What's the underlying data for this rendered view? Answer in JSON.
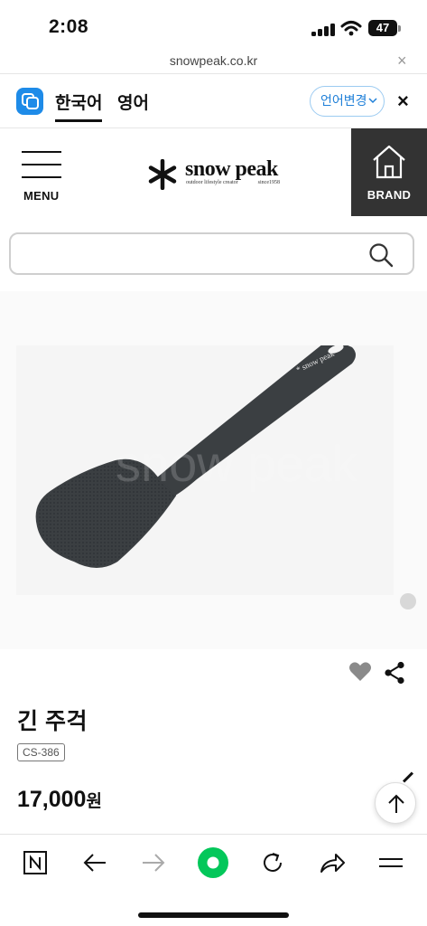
{
  "status_bar": {
    "time": "2:08",
    "battery": "47"
  },
  "browser": {
    "url": "snowpeak.co.kr",
    "close_symbol": "×"
  },
  "translate_bar": {
    "lang_current": "한국어",
    "lang_other": "영어",
    "change_label": "언어변경",
    "close_symbol": "×"
  },
  "header": {
    "menu_label": "MENU",
    "logo_text": "snow peak",
    "logo_tagline": "outdoor lifestyle creator",
    "logo_since": "since1958",
    "brand_label": "BRAND"
  },
  "search": {
    "placeholder": "",
    "value": ""
  },
  "product": {
    "name": "긴 주걱",
    "code": "CS-386",
    "price": "17,000",
    "price_unit": "원",
    "image_watermark": "snow peak"
  },
  "colors": {
    "accent_blue": "#1e8be8",
    "brand_bg": "#333333",
    "naver_green": "#03c75a",
    "utensil": "#3b3f42"
  },
  "icons": [
    "search-icon",
    "heart-icon",
    "share-icon",
    "arrow-up-icon",
    "naver-n-icon",
    "back-arrow-icon",
    "forward-arrow-icon",
    "green-dot-icon",
    "refresh-icon",
    "share-arrow-icon",
    "hamburger-icon",
    "home-icon",
    "translate-icon"
  ]
}
